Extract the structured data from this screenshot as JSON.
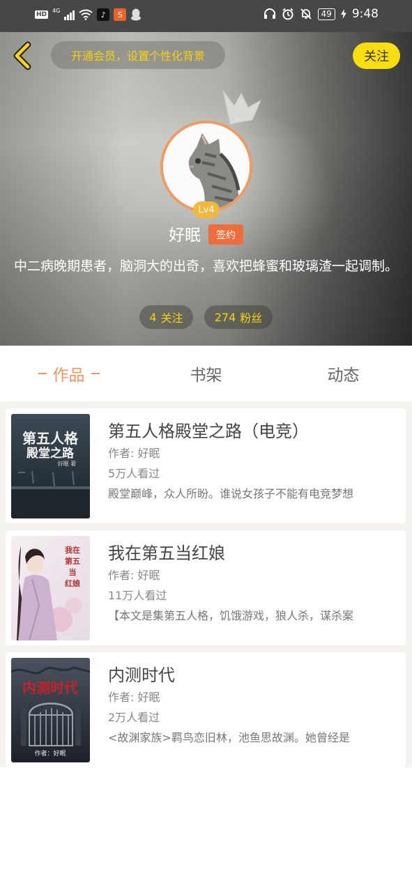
{
  "status_bar": {
    "hd": "HD",
    "network": "4G",
    "time": "9:48",
    "battery": "49",
    "icons": [
      "signal-icon",
      "wifi-icon",
      "tiktok-icon",
      "app-icon",
      "qq-icon",
      "headphones-icon",
      "alarm-icon",
      "mute-icon",
      "battery-icon",
      "charging-icon"
    ]
  },
  "header": {
    "vip_prompt": "开通会员，设置个性化背景",
    "follow_label": "关注",
    "level": "Lv4",
    "username": "好眠",
    "sign_tag": "签约",
    "bio": "中二病晚期患者，脑洞大的出奇，喜欢把蜂蜜和玻璃渣一起调制。",
    "follow_count": "4",
    "follow_count_label": "关注",
    "fans_count": "274",
    "fans_count_label": "粉丝"
  },
  "tabs": [
    {
      "label": "作品",
      "active": true
    },
    {
      "label": "书架",
      "active": false
    },
    {
      "label": "动态",
      "active": false
    }
  ],
  "books": [
    {
      "title": "第五人格殿堂之路（电竞）",
      "author": "作者: 好眠",
      "views": "5万人看过",
      "desc": "殿堂巅峰，众人所盼。谁说女孩子不能有电竞梦想",
      "cover_text": "第五人格殿堂之路",
      "cover_credit": "好眠 著"
    },
    {
      "title": "我在第五当红娘",
      "author": "作者: 好眠",
      "views": "11万人看过",
      "desc": "【本文是集第五人格，饥饿游戏，狼人杀，谋杀案",
      "cover_text": "我在第五当红娘"
    },
    {
      "title": "内测时代",
      "author": "作者: 好眠",
      "views": "2万人看过",
      "desc": "<故渊家族>羁鸟恋旧林，池鱼思故渊。她曾经是",
      "cover_text": "内测时代",
      "cover_credit": "作者：好眠"
    }
  ],
  "colors": {
    "accent_orange": "#f0945a",
    "follow_yellow": "#f8dd12",
    "stat_yellow": "#f5d20f",
    "sign_tag": "#ef6d3b"
  }
}
